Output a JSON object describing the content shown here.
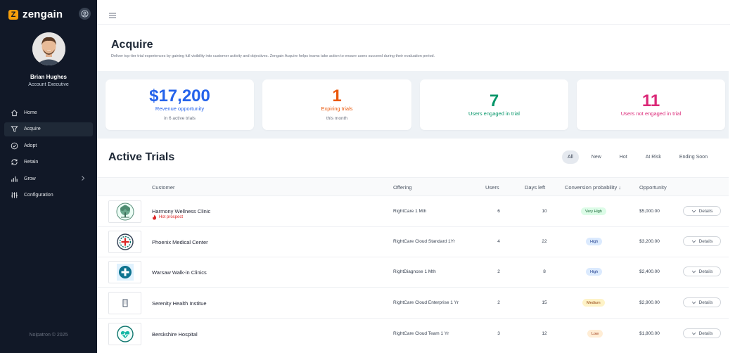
{
  "brand": {
    "name": "zengain",
    "logo_letter": "Z"
  },
  "user": {
    "name": "Brian Hughes",
    "role": "Account Executive"
  },
  "nav": [
    {
      "label": "Home",
      "icon": "home-icon"
    },
    {
      "label": "Acquire",
      "icon": "funnel-icon",
      "active": true
    },
    {
      "label": "Adopt",
      "icon": "check-circle-icon"
    },
    {
      "label": "Retain",
      "icon": "refresh-icon"
    },
    {
      "label": "Grow",
      "icon": "bar-chart-icon",
      "has_submenu": true
    },
    {
      "label": "Configuration",
      "icon": "sliders-icon"
    }
  ],
  "footer": "Noipatron © 2025",
  "page": {
    "title": "Acquire",
    "description": "Deliver top-tier trial experiences by gaining full visibility into customer activity and objectives. Zengain Acquire helps teams take action to ensure users succeed during their evaluation period."
  },
  "stats": [
    {
      "value": "$17,200",
      "label": "Revenue opportunity",
      "sub": "in 6 active trials",
      "color": "#2563eb"
    },
    {
      "value": "1",
      "label": "Expiring trials",
      "sub": "this month",
      "color": "#ea580c"
    },
    {
      "value": "7",
      "label": "Users engaged in trial",
      "sub": "",
      "color": "#059669"
    },
    {
      "value": "11",
      "label": "Users not engaged in trial",
      "sub": "",
      "color": "#db2777"
    }
  ],
  "trials": {
    "title": "Active Trials",
    "filters": [
      "All",
      "New",
      "Hot",
      "At Risk",
      "Ending Soon"
    ],
    "active_filter": "All",
    "columns": {
      "customer": "Customer",
      "offering": "Offering",
      "users": "Users",
      "days_left": "Days left",
      "conversion": "Conversion probability ↓",
      "opportunity": "Opportunity"
    },
    "rows": [
      {
        "customer": "Harmony Wellness Clinic",
        "tag": "Hot prospect",
        "offering": "RightCare 1 Mth",
        "users": "6",
        "days_left": "10",
        "probability": "Very High",
        "opportunity": "$5,000.00",
        "action": "Details",
        "logo": "tree-logo-icon"
      },
      {
        "customer": "Phoenix Medical Center",
        "tag": "",
        "offering": "RightCare Cloud Standard 1Yr",
        "users": "4",
        "days_left": "22",
        "probability": "High",
        "opportunity": "$3,200.00",
        "action": "Details",
        "logo": "emblem-logo-icon"
      },
      {
        "customer": "Warsaw Walk-in Clinics",
        "tag": "",
        "offering": "RightDiagnose 1 Mth",
        "users": "2",
        "days_left": "8",
        "probability": "High",
        "opportunity": "$2,400.00",
        "action": "Details",
        "logo": "medical-cross-logo-icon"
      },
      {
        "customer": "Serenity Health Institue",
        "tag": "",
        "offering": "RightCare Cloud Enterprise 1 Yr",
        "users": "2",
        "days_left": "15",
        "probability": "Medium",
        "opportunity": "$2,900.00",
        "action": "Details",
        "logo": "building-logo-icon"
      },
      {
        "customer": "Berskshire Hospital",
        "tag": "",
        "offering": "RightCare Cloud Team 1 Yr",
        "users": "3",
        "days_left": "12",
        "probability": "Low",
        "opportunity": "$1,800.00",
        "action": "Details",
        "logo": "heart-logo-icon"
      }
    ]
  },
  "colors": {
    "sidebar": "#111827",
    "very_high_bg": "#dcfce7",
    "high_bg": "#dbeafe",
    "medium_bg": "#fef3c7",
    "low_bg": "#ffedd5",
    "hot": "#dc2626"
  }
}
